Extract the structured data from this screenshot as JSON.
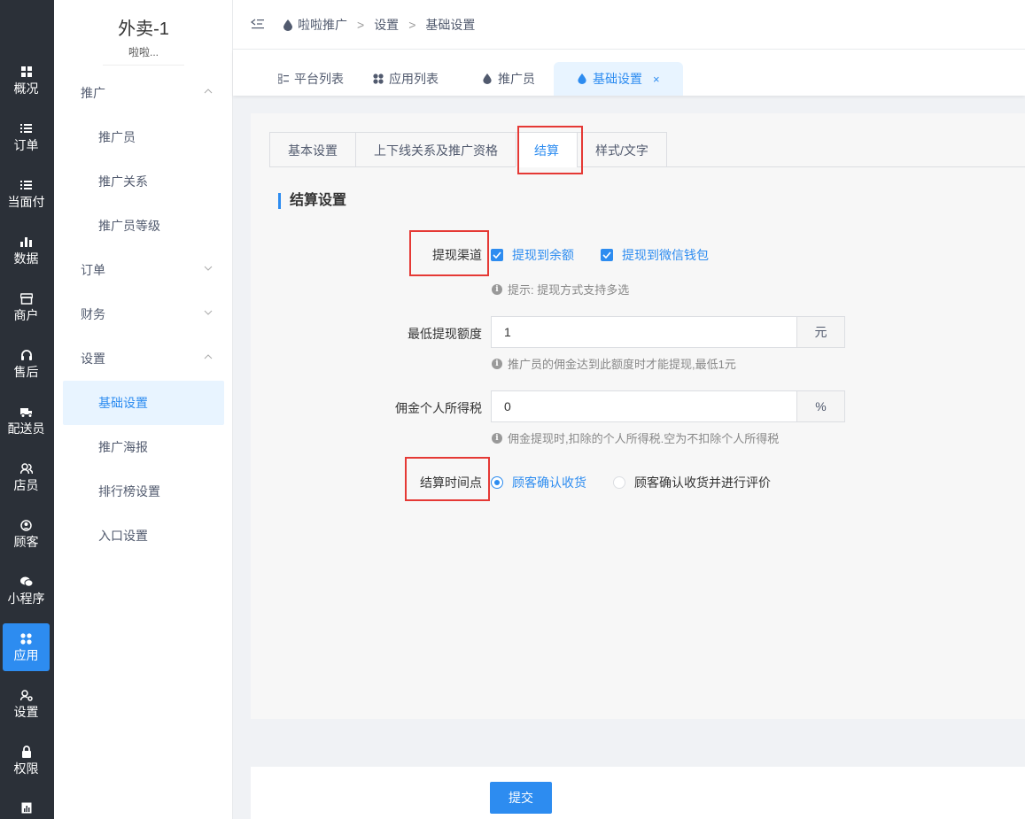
{
  "rail": {
    "items": [
      {
        "label": "概况",
        "icon": "dashboard-icon"
      },
      {
        "label": "订单",
        "icon": "list-icon"
      },
      {
        "label": "当面付",
        "icon": "list-icon"
      },
      {
        "label": "数据",
        "icon": "bar-chart-icon"
      },
      {
        "label": "商户",
        "icon": "store-icon"
      },
      {
        "label": "售后",
        "icon": "headset-icon"
      },
      {
        "label": "配送员",
        "icon": "delivery-icon"
      },
      {
        "label": "店员",
        "icon": "users-icon"
      },
      {
        "label": "顾客",
        "icon": "user-circle-icon"
      },
      {
        "label": "小程序",
        "icon": "wechat-icon"
      },
      {
        "label": "应用",
        "icon": "apps-icon"
      },
      {
        "label": "设置",
        "icon": "user-settings-icon"
      },
      {
        "label": "权限",
        "icon": "lock-icon"
      }
    ],
    "active": "应用"
  },
  "submenu": {
    "store_name": "外卖-1",
    "store_sub": "啦啦...",
    "groups": [
      {
        "label": "推广",
        "items": [
          "推广员",
          "推广关系",
          "推广员等级"
        ]
      },
      {
        "label": "订单",
        "items": []
      },
      {
        "label": "财务",
        "items": []
      },
      {
        "label": "设置",
        "items": [
          "基础设置",
          "推广海报",
          "排行榜设置",
          "入口设置"
        ]
      }
    ],
    "active_item": "基础设置"
  },
  "breadcrumb": [
    "啦啦推广",
    "设置",
    "基础设置"
  ],
  "page_tabs": [
    {
      "label": "平台列表",
      "icon": "list-icon"
    },
    {
      "label": "应用列表",
      "icon": "apps-icon"
    },
    {
      "label": "推广员",
      "icon": "drop-icon"
    },
    {
      "label": "基础设置",
      "icon": "drop-icon",
      "closable": true,
      "close": "×"
    }
  ],
  "inner_tabs": [
    "基本设置",
    "上下线关系及推广资格",
    "结算",
    "样式/文字"
  ],
  "active_inner_tab": "结算",
  "section_title": "结算设置",
  "form": {
    "withdraw_channel": {
      "label": "提现渠道",
      "options": [
        {
          "label": "提现到余额",
          "checked": true
        },
        {
          "label": "提现到微信钱包",
          "checked": true
        }
      ],
      "hint": "提示: 提现方式支持多选"
    },
    "min_withdraw": {
      "label": "最低提现额度",
      "value": "1",
      "suffix": "元",
      "hint": "推广员的佣金达到此额度时才能提现,最低1元"
    },
    "tax": {
      "label": "佣金个人所得税",
      "value": "0",
      "suffix": "%",
      "hint": "佣金提现时,扣除的个人所得税.空为不扣除个人所得税"
    },
    "settle_time": {
      "label": "结算时间点",
      "options": [
        {
          "label": "顾客确认收货",
          "selected": true
        },
        {
          "label": "顾客确认收货并进行评价",
          "selected": false
        }
      ]
    }
  },
  "submit_label": "提交",
  "colors": {
    "accent": "#2d8cf0",
    "rail_bg": "#2b3038",
    "highlight": "#e53935"
  }
}
